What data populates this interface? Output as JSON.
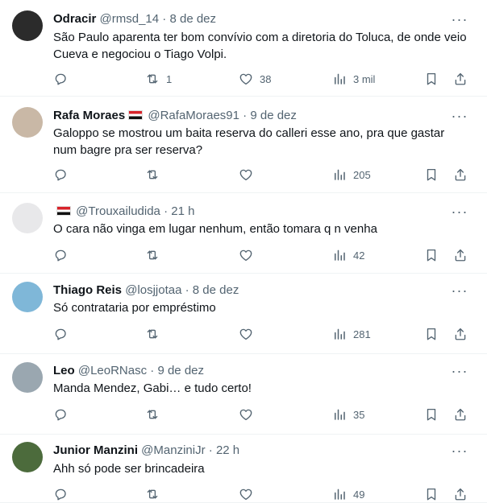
{
  "tweets": [
    {
      "name": "Odracir",
      "flag": false,
      "handle": "@rmsd_14",
      "separator": "·",
      "time": "8 de dez",
      "text": "São Paulo aparenta ter bom convívio com a diretoria do Toluca, de onde veio Cueva e negociou o Tiago Volpi.",
      "replies": "",
      "retweets": "1",
      "likes": "38",
      "views": "3 mil",
      "avatar_color": "#2b2b2b"
    },
    {
      "name": "Rafa Moraes",
      "flag": true,
      "handle": "@RafaMoraes91",
      "separator": "·",
      "time": "9 de dez",
      "text": "Galoppo se mostrou um baita reserva do calleri esse ano, pra que gastar num bagre pra ser reserva?",
      "replies": "",
      "retweets": "",
      "likes": "",
      "views": "205",
      "avatar_color": "#c9b8a6"
    },
    {
      "name": "",
      "flag": true,
      "handle": "@Trouxailudida",
      "separator": "·",
      "time": "21 h",
      "text": "O cara não vinga em lugar nenhum, então tomara q n venha",
      "replies": "",
      "retweets": "",
      "likes": "",
      "views": "42",
      "avatar_color": "#e8e8ea"
    },
    {
      "name": "Thiago Reis",
      "flag": false,
      "handle": "@losjjotaa",
      "separator": "·",
      "time": "8 de dez",
      "text": "Só contrataria por empréstimo",
      "replies": "",
      "retweets": "",
      "likes": "",
      "views": "281",
      "avatar_color": "#7fb7d8"
    },
    {
      "name": "Leo",
      "flag": false,
      "handle": "@LeoRNasc",
      "separator": "·",
      "time": "9 de dez",
      "text": "Manda Mendez, Gabi… e tudo certo!",
      "replies": "",
      "retweets": "",
      "likes": "",
      "views": "35",
      "avatar_color": "#9aa7b0"
    },
    {
      "name": "Junior Manzini",
      "flag": false,
      "handle": "@ManziniJr",
      "separator": "·",
      "time": "22 h",
      "text": "Ahh só pode ser brincadeira",
      "replies": "",
      "retweets": "",
      "likes": "",
      "views": "49",
      "avatar_color": "#4c6b3c"
    }
  ],
  "icons": {
    "more": "more-icon",
    "reply": "reply-icon",
    "retweet": "retweet-icon",
    "like": "heart-icon",
    "views": "views-icon",
    "bookmark": "bookmark-icon",
    "share": "share-icon"
  },
  "colors": {
    "text": "#0f1419",
    "secondary": "#536471",
    "divider": "#eff3f4"
  }
}
